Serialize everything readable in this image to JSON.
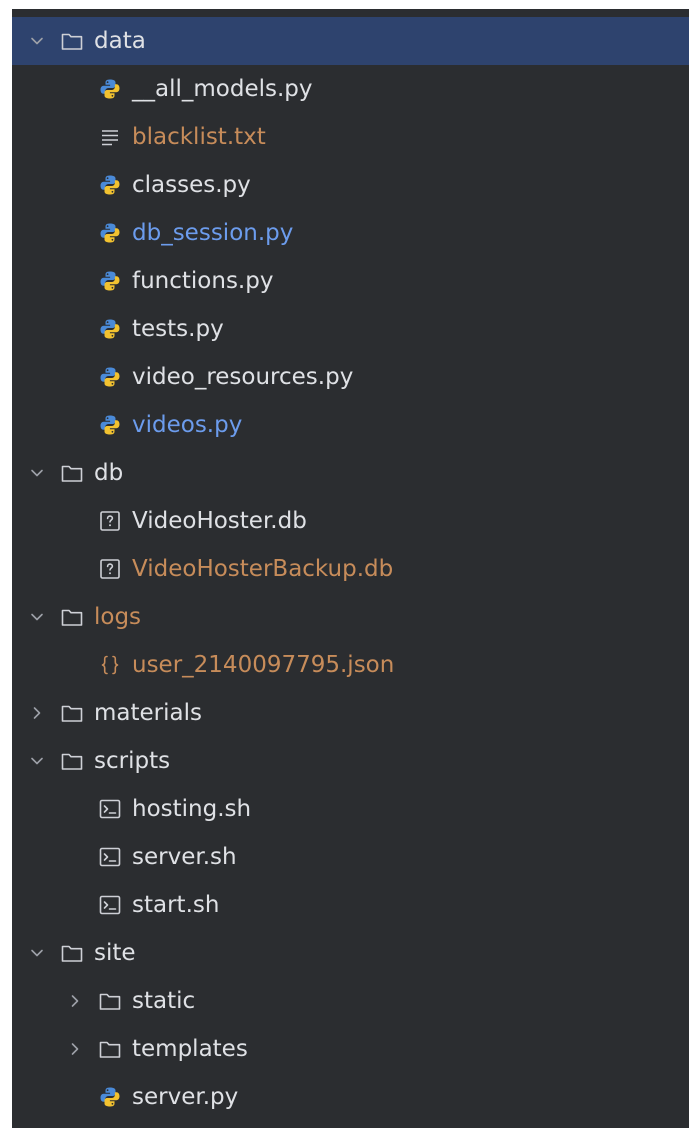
{
  "colors": {
    "background": "#2b2d30",
    "selected": "#2e436e",
    "text_default": "#dfe1e5",
    "text_modified": "#6c9ced",
    "text_ignored": "#c78c5a"
  },
  "tree": [
    {
      "label": "data",
      "type": "folder",
      "depth": 0,
      "expanded": true,
      "selected": true,
      "color": "default",
      "icon": "folder-icon"
    },
    {
      "label": "__all_models.py",
      "type": "file",
      "depth": 1,
      "color": "default",
      "icon": "python-icon"
    },
    {
      "label": "blacklist.txt",
      "type": "file",
      "depth": 1,
      "color": "orange",
      "icon": "text-file-icon"
    },
    {
      "label": "classes.py",
      "type": "file",
      "depth": 1,
      "color": "default",
      "icon": "python-icon"
    },
    {
      "label": "db_session.py",
      "type": "file",
      "depth": 1,
      "color": "blue",
      "icon": "python-icon"
    },
    {
      "label": "functions.py",
      "type": "file",
      "depth": 1,
      "color": "default",
      "icon": "python-icon"
    },
    {
      "label": "tests.py",
      "type": "file",
      "depth": 1,
      "color": "default",
      "icon": "python-icon"
    },
    {
      "label": "video_resources.py",
      "type": "file",
      "depth": 1,
      "color": "default",
      "icon": "python-icon"
    },
    {
      "label": "videos.py",
      "type": "file",
      "depth": 1,
      "color": "blue",
      "icon": "python-icon"
    },
    {
      "label": "db",
      "type": "folder",
      "depth": 0,
      "expanded": true,
      "color": "default",
      "icon": "folder-icon"
    },
    {
      "label": "VideoHoster.db",
      "type": "file",
      "depth": 1,
      "color": "default",
      "icon": "unknown-file-icon"
    },
    {
      "label": "VideoHosterBackup.db",
      "type": "file",
      "depth": 1,
      "color": "orange",
      "icon": "unknown-file-icon"
    },
    {
      "label": "logs",
      "type": "folder",
      "depth": 0,
      "expanded": true,
      "color": "orange",
      "icon": "folder-icon"
    },
    {
      "label": "user_2140097795.json",
      "type": "file",
      "depth": 1,
      "color": "orange",
      "icon": "json-icon"
    },
    {
      "label": "materials",
      "type": "folder",
      "depth": 0,
      "expanded": false,
      "color": "default",
      "icon": "folder-icon"
    },
    {
      "label": "scripts",
      "type": "folder",
      "depth": 0,
      "expanded": true,
      "color": "default",
      "icon": "folder-icon"
    },
    {
      "label": "hosting.sh",
      "type": "file",
      "depth": 1,
      "color": "default",
      "icon": "shell-icon"
    },
    {
      "label": "server.sh",
      "type": "file",
      "depth": 1,
      "color": "default",
      "icon": "shell-icon"
    },
    {
      "label": "start.sh",
      "type": "file",
      "depth": 1,
      "color": "default",
      "icon": "shell-icon"
    },
    {
      "label": "site",
      "type": "folder",
      "depth": 0,
      "expanded": true,
      "color": "default",
      "icon": "folder-icon"
    },
    {
      "label": "static",
      "type": "folder",
      "depth": 1,
      "expanded": false,
      "color": "default",
      "icon": "folder-icon"
    },
    {
      "label": "templates",
      "type": "folder",
      "depth": 1,
      "expanded": false,
      "color": "default",
      "icon": "folder-icon"
    },
    {
      "label": "server.py",
      "type": "file",
      "depth": 1,
      "color": "default",
      "icon": "python-icon"
    }
  ]
}
